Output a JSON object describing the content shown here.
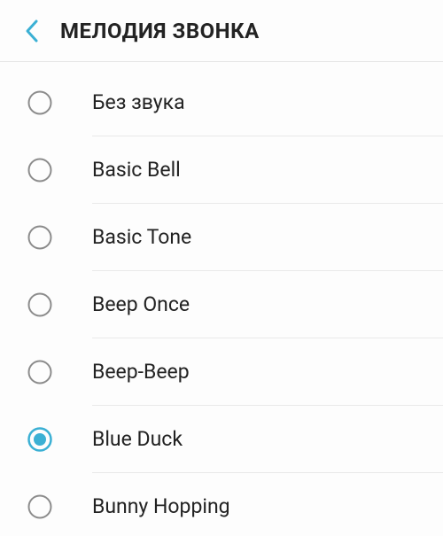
{
  "header": {
    "title": "МЕЛОДИЯ ЗВОНКА"
  },
  "colors": {
    "accent": "#3bb0d4",
    "radio_border": "#8c8c8c"
  },
  "ringtones": [
    {
      "label": "Без звука",
      "selected": false
    },
    {
      "label": "Basic Bell",
      "selected": false
    },
    {
      "label": "Basic Tone",
      "selected": false
    },
    {
      "label": "Beep Once",
      "selected": false
    },
    {
      "label": "Beep-Beep",
      "selected": false
    },
    {
      "label": "Blue Duck",
      "selected": true
    },
    {
      "label": "Bunny Hopping",
      "selected": false
    }
  ]
}
